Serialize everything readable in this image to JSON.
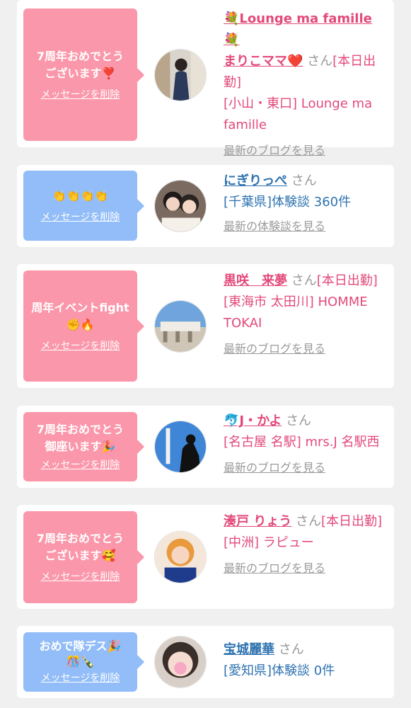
{
  "cards": [
    {
      "message": "7周年おめでとう\nございます❣️",
      "delete_label": "メッセージを削除",
      "name": "💐Lounge ma famille💐\nまりこママ❤️",
      "suffix": "さん",
      "status": "[本日出勤]",
      "location": "[小山・東口] Lounge ma famille",
      "link": "最新のブログを見る",
      "bubble_color": "#fb97aa"
    },
    {
      "message": "👏👏👏👏",
      "delete_label": "メッセージを削除",
      "name": "にぎりっぺ",
      "suffix": "さん",
      "location": "[千葉県]体験談 360件",
      "link": "最新の体験談を見る",
      "bubble_color": "#92bdf8"
    },
    {
      "message": "周年イベントfight\n✊🔥",
      "delete_label": "メッセージを削除",
      "name": "黒咲　来夢",
      "suffix": "さん",
      "status": "[本日出勤]",
      "location": "[東海市 太田川] HOMME TOKAI",
      "link": "最新のブログを見る",
      "bubble_color": "#fb97aa"
    },
    {
      "message": "7周年おめでとう\n御座います🎉",
      "delete_label": "メッセージを削除",
      "name": "🐬J・かよ",
      "suffix": "さん",
      "location": "[名古屋 名駅] mrs.J 名駅西",
      "link": "最新のブログを見る",
      "bubble_color": "#fb97aa"
    },
    {
      "message": "7周年おめでとう\nございます🥰",
      "delete_label": "メッセージを削除",
      "name": "湊戸 りょう",
      "suffix": "さん",
      "status": "[本日出勤]",
      "location": "[中洲] ラピュー",
      "link": "最新のブログを見る",
      "bubble_color": "#fb97aa"
    },
    {
      "message": "おめで隊デス🎉\n🎊🍾",
      "delete_label": "メッセージを削除",
      "name": "宝城麗華",
      "suffix": "さん",
      "location": "[愛知県]体験談 0件",
      "bubble_color": "#92bdf8"
    }
  ]
}
